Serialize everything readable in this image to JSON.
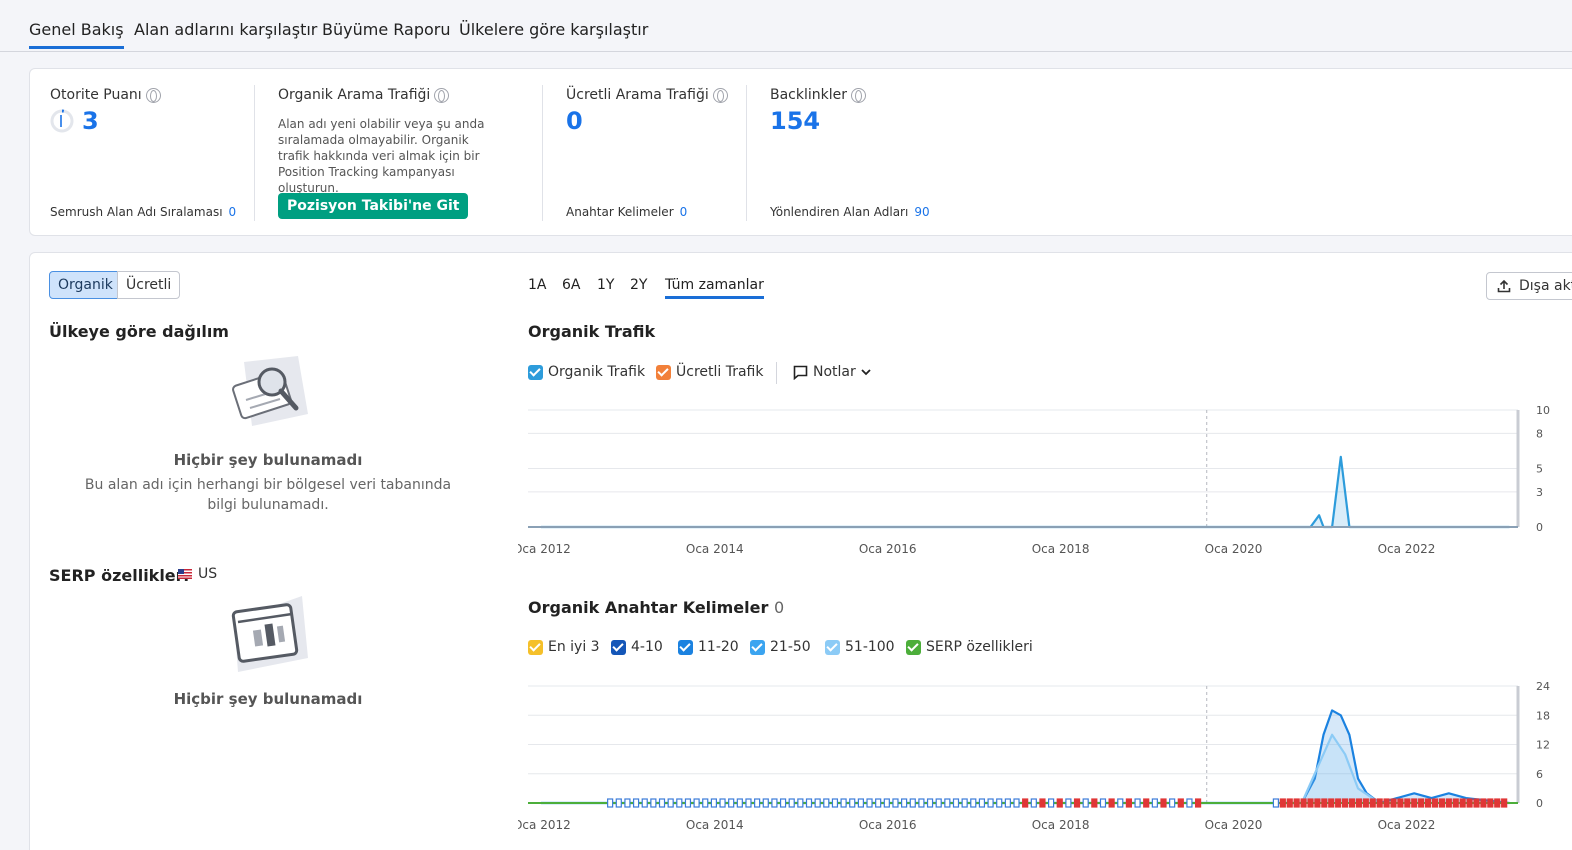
{
  "tabs": [
    "Genel Bakış",
    "Alan adlarını karşılaştır",
    "Büyüme Raporu",
    "Ülkelere göre karşılaştır"
  ],
  "metrics": {
    "authority": {
      "title": "Otorite Puanı",
      "value": "3",
      "sub_label": "Semrush Alan Adı Sıralaması",
      "sub_value": "0"
    },
    "organic": {
      "title": "Organik Arama Trafiği",
      "desc": "Alan adı yeni olabilir veya şu anda sıralamada olmayabilir. Organik trafik hakkında veri almak için bir Position Tracking kampanyası oluşturun.",
      "button": "Pozisyon Takibi'ne Git"
    },
    "paid": {
      "title": "Ücretli Arama Trafiği",
      "value": "0",
      "sub_label": "Anahtar Kelimeler",
      "sub_value": "0"
    },
    "backlinks": {
      "title": "Backlinkler",
      "value": "154",
      "sub_label": "Yönlendiren Alan Adları",
      "sub_value": "90"
    }
  },
  "segments": {
    "organic": "Organik",
    "paid": "Ücretli"
  },
  "country": {
    "title": "Ülkeye göre dağılım",
    "empty_title": "Hiçbir şey bulunamadı",
    "empty_desc": "Bu alan adı için herhangi bir bölgesel veri tabanında bilgi bulunamadı."
  },
  "serp": {
    "title": "SERP özellikleri",
    "flag": "US",
    "empty_title": "Hiçbir şey bulunamadı"
  },
  "periods": [
    "1A",
    "6A",
    "1Y",
    "2Y",
    "Tüm zamanlar"
  ],
  "export": "Dışa akt",
  "traffic": {
    "title": "Organik Trafik",
    "legend": [
      {
        "label": "Organik Trafik",
        "color": "#2d9cdb"
      },
      {
        "label": "Ücretli Trafik",
        "color": "#f2803a"
      }
    ],
    "notes": "Notlar"
  },
  "keywords": {
    "title": "Organik Anahtar Kelimeler",
    "count": "0",
    "legend": [
      {
        "label": "En iyi 3",
        "color": "#f5c02a"
      },
      {
        "label": "4-10",
        "color": "#1456b8"
      },
      {
        "label": "11-20",
        "color": "#1b82e0"
      },
      {
        "label": "21-50",
        "color": "#3ba4f0"
      },
      {
        "label": "51-100",
        "color": "#8ccbf6"
      },
      {
        "label": "SERP özellikleri",
        "color": "#4cae3a"
      }
    ]
  },
  "chart_data": [
    {
      "type": "area",
      "title": "Organik Trafik",
      "x_labels": [
        "Oca 2012",
        "Oca 2014",
        "Oca 2016",
        "Oca 2018",
        "Oca 2020",
        "Oca 2022"
      ],
      "y_ticks": [
        "10",
        "8",
        "5",
        "3",
        "0"
      ],
      "ylim": [
        0,
        10
      ],
      "series": [
        {
          "name": "Organik Trafik",
          "points": [
            [
              2012.0,
              0
            ],
            [
              2019.8,
              0
            ],
            [
              2020.9,
              0
            ],
            [
              2021.0,
              1
            ],
            [
              2021.05,
              0
            ],
            [
              2021.15,
              0
            ],
            [
              2021.25,
              6
            ],
            [
              2021.35,
              0
            ],
            [
              2023.2,
              0
            ]
          ]
        }
      ]
    },
    {
      "type": "area",
      "title": "Organik Anahtar Kelimeler",
      "x_labels": [
        "Oca 2012",
        "Oca 2014",
        "Oca 2016",
        "Oca 2018",
        "Oca 2020",
        "Oca 2022"
      ],
      "y_ticks": [
        "24",
        "18",
        "12",
        "6",
        "0"
      ],
      "ylim": [
        0,
        24
      ],
      "series": [
        {
          "name": "4-10",
          "points": [
            [
              2012.0,
              0
            ],
            [
              2020.8,
              0
            ],
            [
              2020.95,
              5
            ],
            [
              2021.05,
              14
            ],
            [
              2021.15,
              19
            ],
            [
              2021.25,
              18
            ],
            [
              2021.35,
              14
            ],
            [
              2021.45,
              5
            ],
            [
              2021.55,
              2
            ],
            [
              2021.7,
              0
            ],
            [
              2021.9,
              1
            ],
            [
              2022.1,
              2
            ],
            [
              2022.3,
              1
            ],
            [
              2022.5,
              2
            ],
            [
              2022.7,
              1
            ],
            [
              2023.2,
              0
            ]
          ]
        },
        {
          "name": "21-50",
          "points": [
            [
              2012.0,
              0
            ],
            [
              2020.8,
              0
            ],
            [
              2021.0,
              8
            ],
            [
              2021.15,
              14
            ],
            [
              2021.3,
              10
            ],
            [
              2021.45,
              3
            ],
            [
              2021.7,
              0
            ],
            [
              2023.2,
              0
            ]
          ]
        }
      ]
    }
  ]
}
